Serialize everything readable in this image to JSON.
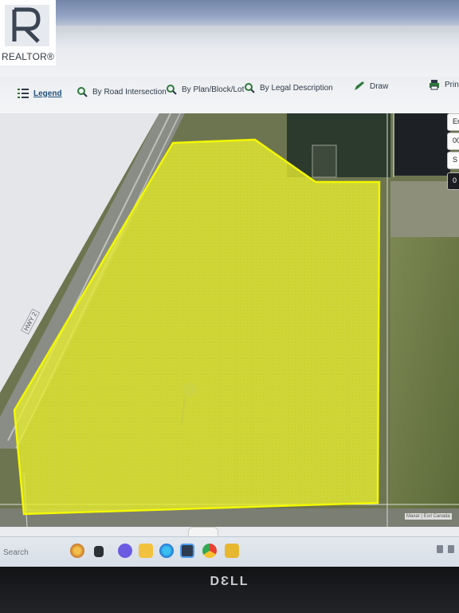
{
  "logo": {
    "text": "REALTOR®"
  },
  "toolbar": {
    "legend": "Legend",
    "road": "By Road Intersection",
    "plan": "By Plan/Block/Lot",
    "legal": "By Legal Description",
    "draw": "Draw",
    "print": "Print"
  },
  "map": {
    "highway_label": "HWY 2",
    "attribution": "Maxar | Esri Canada",
    "parcel_color": "#e8ee2a",
    "controls": [
      "En",
      "00",
      "S",
      "0"
    ]
  },
  "taskbar": {
    "search": "Search"
  },
  "bezel": {
    "brand": "DƐLL"
  },
  "colors": {
    "highlight": "#e8ee2a",
    "toolbar_text": "#2e3b4a"
  }
}
